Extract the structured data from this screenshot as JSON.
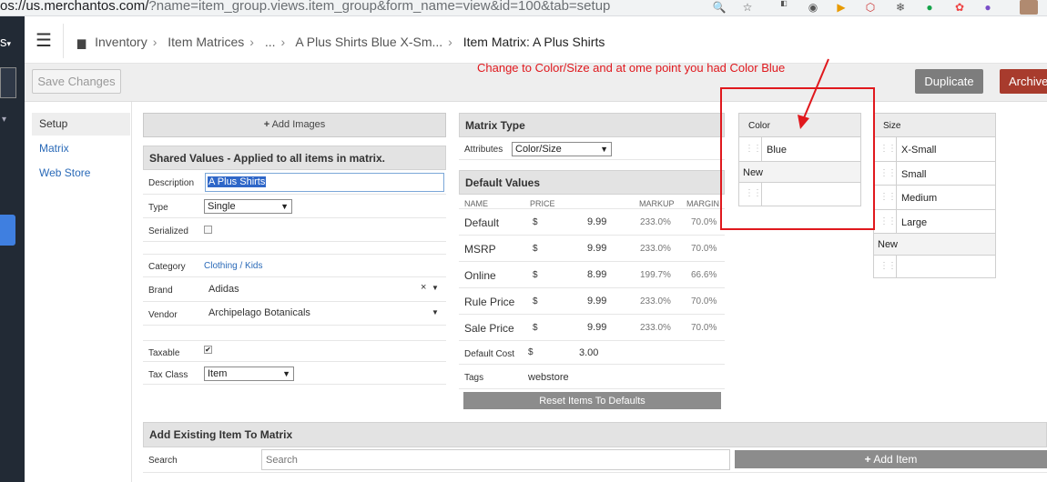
{
  "browser": {
    "url_main": "os://us.merchantos.com/",
    "url_tail": "?name=item_group.views.item_group&form_name=view&id=100&tab=setup"
  },
  "nav": {
    "truncated_label": "s"
  },
  "header": {
    "breadcrumbs": [
      "Inventory",
      "Item Matrices",
      "...",
      "A Plus Shirts Blue X-Sm...",
      "Item Matrix:  A Plus Shirts"
    ]
  },
  "toolbar": {
    "save_label": "Save Changes",
    "duplicate_label": "Duplicate",
    "archive_label": "Archive",
    "annotation": "Change to Color/Size and at ome point you had Color Blue"
  },
  "tabs": [
    "Setup",
    "Matrix",
    "Web Store"
  ],
  "shared": {
    "add_images": "Add Images",
    "title": "Shared Values - Applied to all items in matrix.",
    "description_label": "Description",
    "description_value": "A Plus Shirts",
    "type_label": "Type",
    "type_value": "Single",
    "serialized_label": "Serialized",
    "category_label": "Category",
    "category_value": "Clothing / Kids",
    "brand_label": "Brand",
    "brand_value": "Adidas",
    "vendor_label": "Vendor",
    "vendor_value": "Archipelago Botanicals",
    "taxable_label": "Taxable",
    "taxclass_label": "Tax Class",
    "taxclass_value": "Item"
  },
  "matrix_type": {
    "title": "Matrix Type",
    "attributes_label": "Attributes",
    "attributes_value": "Color/Size"
  },
  "default_values": {
    "title": "Default Values",
    "headers": [
      "NAME",
      "PRICE",
      "",
      "MARKUP",
      "MARGIN"
    ],
    "rows": [
      {
        "name": "Default",
        "cur": "$",
        "price": "9.99",
        "markup": "233.0%",
        "margin": "70.0%"
      },
      {
        "name": "MSRP",
        "cur": "$",
        "price": "9.99",
        "markup": "233.0%",
        "margin": "70.0%"
      },
      {
        "name": "Online",
        "cur": "$",
        "price": "8.99",
        "markup": "199.7%",
        "margin": "66.6%"
      },
      {
        "name": "Rule Price",
        "cur": "$",
        "price": "9.99",
        "markup": "233.0%",
        "margin": "70.0%"
      },
      {
        "name": "Sale Price",
        "cur": "$",
        "price": "9.99",
        "markup": "233.0%",
        "margin": "70.0%"
      }
    ],
    "default_cost_label": "Default Cost",
    "default_cost_cur": "$",
    "default_cost_value": "3.00",
    "tags_label": "Tags",
    "tags_value": "webstore",
    "reset_label": "Reset Items To Defaults"
  },
  "color_grid": {
    "header": "Color",
    "values": [
      "Blue"
    ],
    "new_label": "New"
  },
  "size_grid": {
    "header": "Size",
    "values": [
      "X-Small",
      "Small",
      "Medium",
      "Large"
    ],
    "new_label": "New"
  },
  "add_existing": {
    "title": "Add Existing Item To Matrix",
    "search_label": "Search",
    "search_placeholder": "Search",
    "add_item_label": "Add Item"
  },
  "colors": {
    "annotation_red": "#e0181d",
    "archive": "#a83b2d",
    "duplicate": "#7d7d7d",
    "nav_bg": "#222a35",
    "link": "#2a6ab8"
  }
}
